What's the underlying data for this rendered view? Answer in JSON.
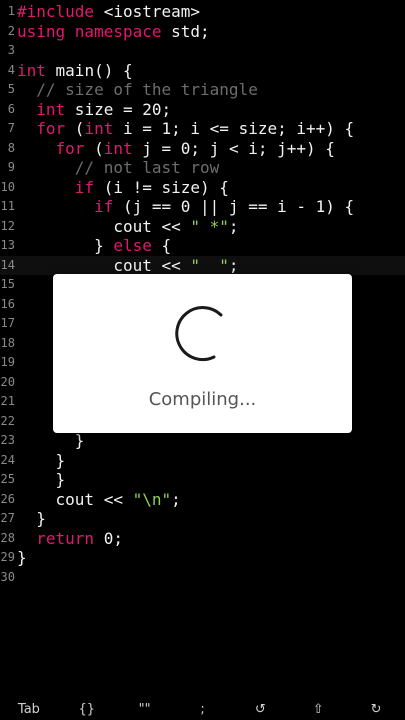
{
  "editor": {
    "lines": [
      {
        "n": "1",
        "tokens": [
          {
            "t": "#include",
            "c": "kw"
          },
          {
            "t": " <iostream>",
            "c": ""
          }
        ]
      },
      {
        "n": "2",
        "tokens": [
          {
            "t": "using namespace",
            "c": "kw"
          },
          {
            "t": " std;",
            "c": ""
          }
        ]
      },
      {
        "n": "3",
        "tokens": []
      },
      {
        "n": "4",
        "tokens": [
          {
            "t": "int",
            "c": "kw"
          },
          {
            "t": " main() {",
            "c": ""
          }
        ]
      },
      {
        "n": "5",
        "tokens": [
          {
            "t": "  ",
            "c": ""
          },
          {
            "t": "// size of the triangle",
            "c": "cm"
          }
        ]
      },
      {
        "n": "6",
        "tokens": [
          {
            "t": "  ",
            "c": ""
          },
          {
            "t": "int",
            "c": "kw"
          },
          {
            "t": " size = 20;",
            "c": ""
          }
        ]
      },
      {
        "n": "7",
        "tokens": [
          {
            "t": "  ",
            "c": ""
          },
          {
            "t": "for",
            "c": "kw"
          },
          {
            "t": " (",
            "c": ""
          },
          {
            "t": "int",
            "c": "kw"
          },
          {
            "t": " i = 1; i <= size; i++) {",
            "c": ""
          }
        ]
      },
      {
        "n": "8",
        "tokens": [
          {
            "t": "    ",
            "c": ""
          },
          {
            "t": "for",
            "c": "kw"
          },
          {
            "t": " (",
            "c": ""
          },
          {
            "t": "int",
            "c": "kw"
          },
          {
            "t": " j = 0; j < i; j++) {",
            "c": ""
          }
        ]
      },
      {
        "n": "9",
        "tokens": [
          {
            "t": "      ",
            "c": ""
          },
          {
            "t": "// not last row",
            "c": "cm"
          }
        ]
      },
      {
        "n": "10",
        "tokens": [
          {
            "t": "      ",
            "c": ""
          },
          {
            "t": "if",
            "c": "kw"
          },
          {
            "t": " (i != size) {",
            "c": ""
          }
        ]
      },
      {
        "n": "11",
        "tokens": [
          {
            "t": "        ",
            "c": ""
          },
          {
            "t": "if",
            "c": "kw"
          },
          {
            "t": " (j == 0 || j == i - 1) {",
            "c": ""
          }
        ]
      },
      {
        "n": "12",
        "tokens": [
          {
            "t": "          cout << ",
            "c": ""
          },
          {
            "t": "\" *\"",
            "c": "str"
          },
          {
            "t": ";",
            "c": ""
          }
        ]
      },
      {
        "n": "13",
        "tokens": [
          {
            "t": "        } ",
            "c": ""
          },
          {
            "t": "else",
            "c": "kw"
          },
          {
            "t": " {",
            "c": ""
          }
        ]
      },
      {
        "n": "14",
        "tokens": [
          {
            "t": "          cout << ",
            "c": ""
          },
          {
            "t": "\"  \"",
            "c": "str"
          },
          {
            "t": ";",
            "c": ""
          }
        ]
      },
      {
        "n": "15",
        "tokens": []
      },
      {
        "n": "16",
        "tokens": []
      },
      {
        "n": "17",
        "tokens": []
      },
      {
        "n": "18",
        "tokens": []
      },
      {
        "n": "19",
        "tokens": []
      },
      {
        "n": "20",
        "tokens": []
      },
      {
        "n": "21",
        "tokens": []
      },
      {
        "n": "22",
        "tokens": []
      },
      {
        "n": "23",
        "tokens": [
          {
            "t": "      }",
            "c": ""
          }
        ]
      },
      {
        "n": "24",
        "tokens": [
          {
            "t": "    }",
            "c": ""
          }
        ]
      },
      {
        "n": "25",
        "tokens": [
          {
            "t": "    }",
            "c": ""
          }
        ]
      },
      {
        "n": "26",
        "tokens": [
          {
            "t": "    cout << ",
            "c": ""
          },
          {
            "t": "\"\\n\"",
            "c": "str"
          },
          {
            "t": ";",
            "c": ""
          }
        ]
      },
      {
        "n": "27",
        "tokens": [
          {
            "t": "  }",
            "c": ""
          }
        ]
      },
      {
        "n": "28",
        "tokens": [
          {
            "t": "  ",
            "c": ""
          },
          {
            "t": "return",
            "c": "kw"
          },
          {
            "t": " 0;",
            "c": ""
          }
        ]
      },
      {
        "n": "29",
        "tokens": [
          {
            "t": "}",
            "c": ""
          }
        ]
      },
      {
        "n": "30",
        "tokens": []
      }
    ],
    "current_line": "14"
  },
  "dialog": {
    "message": "Compiling...",
    "spinner_icon": "loading-spinner-icon"
  },
  "keybar": {
    "keys": [
      {
        "label": "Tab",
        "name": "tab-key"
      },
      {
        "label": "{}",
        "name": "braces-key"
      },
      {
        "label": "\"\"",
        "name": "quotes-key"
      },
      {
        "label": ";",
        "name": "semicolon-key"
      },
      {
        "label": "↺",
        "name": "undo-key"
      },
      {
        "label": "⇧",
        "name": "shift-key"
      },
      {
        "label": "↻",
        "name": "redo-key"
      }
    ]
  },
  "colors": {
    "background": "#000000",
    "keyword": "#e0186f",
    "string": "#8fd05a",
    "comment": "#6d6d6d",
    "text": "#f2f2f2",
    "line_number": "#8a8a8a"
  }
}
